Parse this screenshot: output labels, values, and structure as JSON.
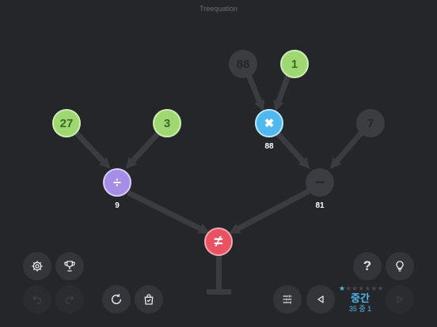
{
  "app": {
    "title": "Treequation"
  },
  "tree": {
    "leaves": [
      {
        "id": "leaf-27",
        "label": "27",
        "state": "active"
      },
      {
        "id": "leaf-3",
        "label": "3",
        "state": "active"
      },
      {
        "id": "leaf-88",
        "label": "88",
        "state": "inactive"
      },
      {
        "id": "leaf-1",
        "label": "1",
        "state": "active"
      },
      {
        "id": "leaf-7",
        "label": "7",
        "state": "inactive"
      }
    ],
    "operators": [
      {
        "id": "divide",
        "symbol": "÷",
        "result": "9",
        "color": "#a58fe6"
      },
      {
        "id": "multiply",
        "symbol": "✖",
        "result": "88",
        "color": "#4fb8ee"
      },
      {
        "id": "subtract",
        "symbol": "−",
        "result": "81",
        "color": "#3b3d42"
      },
      {
        "id": "root",
        "symbol": "≠",
        "result": "",
        "color": "#e85262"
      }
    ]
  },
  "controls": {
    "left": [
      "gear-icon",
      "trophy-icon",
      "undo-icon",
      "redo-icon",
      "restart-icon",
      "bag-icon"
    ],
    "right": [
      "help-icon",
      "hint-icon",
      "sliders-icon",
      "prev-icon",
      "next-icon"
    ],
    "help_label": "?"
  },
  "level": {
    "difficulty": "중간",
    "progress": "35 중 1",
    "stars_filled": 1,
    "stars_total": 7
  },
  "colors": {
    "background": "#252629",
    "green": "#9fd873",
    "blue": "#4fb8ee",
    "purple": "#a58fe6",
    "red": "#e85262",
    "dark": "#3b3d42"
  }
}
